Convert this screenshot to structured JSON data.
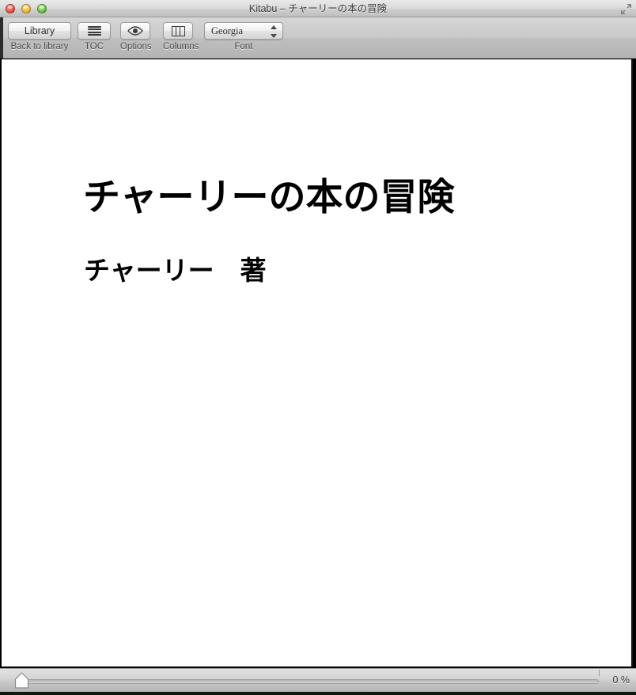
{
  "window": {
    "title": "Kitabu – チャーリーの本の冒険",
    "close_label": "close",
    "minimize_label": "minimize",
    "zoom_label": "zoom",
    "fullscreen_label": "fullscreen"
  },
  "toolbar": {
    "library": {
      "button_label": "Library",
      "caption": "Back to library"
    },
    "toc": {
      "icon": "hamburger-icon",
      "caption": "TOC"
    },
    "options": {
      "icon": "eye-icon",
      "caption": "Options"
    },
    "columns": {
      "icon": "columns-icon",
      "caption": "Columns"
    },
    "font": {
      "value": "Georgia",
      "caption": "Font",
      "options": [
        "Georgia"
      ],
      "stepper_up": "increase",
      "stepper_down": "decrease"
    }
  },
  "content": {
    "book_title": "チャーリーの本の冒険",
    "book_author": "チャーリー　著"
  },
  "status": {
    "progress_percent_label": "0 %",
    "progress_value": 0
  },
  "colors": {
    "titlebar_top": "#e9e9e9",
    "toolbar_top": "#d6d6d6",
    "page_background": "#ffffff",
    "text": "#000000",
    "traffic_red": "#e8453c",
    "traffic_yellow": "#f0b02e",
    "traffic_green": "#5bbd3e"
  }
}
